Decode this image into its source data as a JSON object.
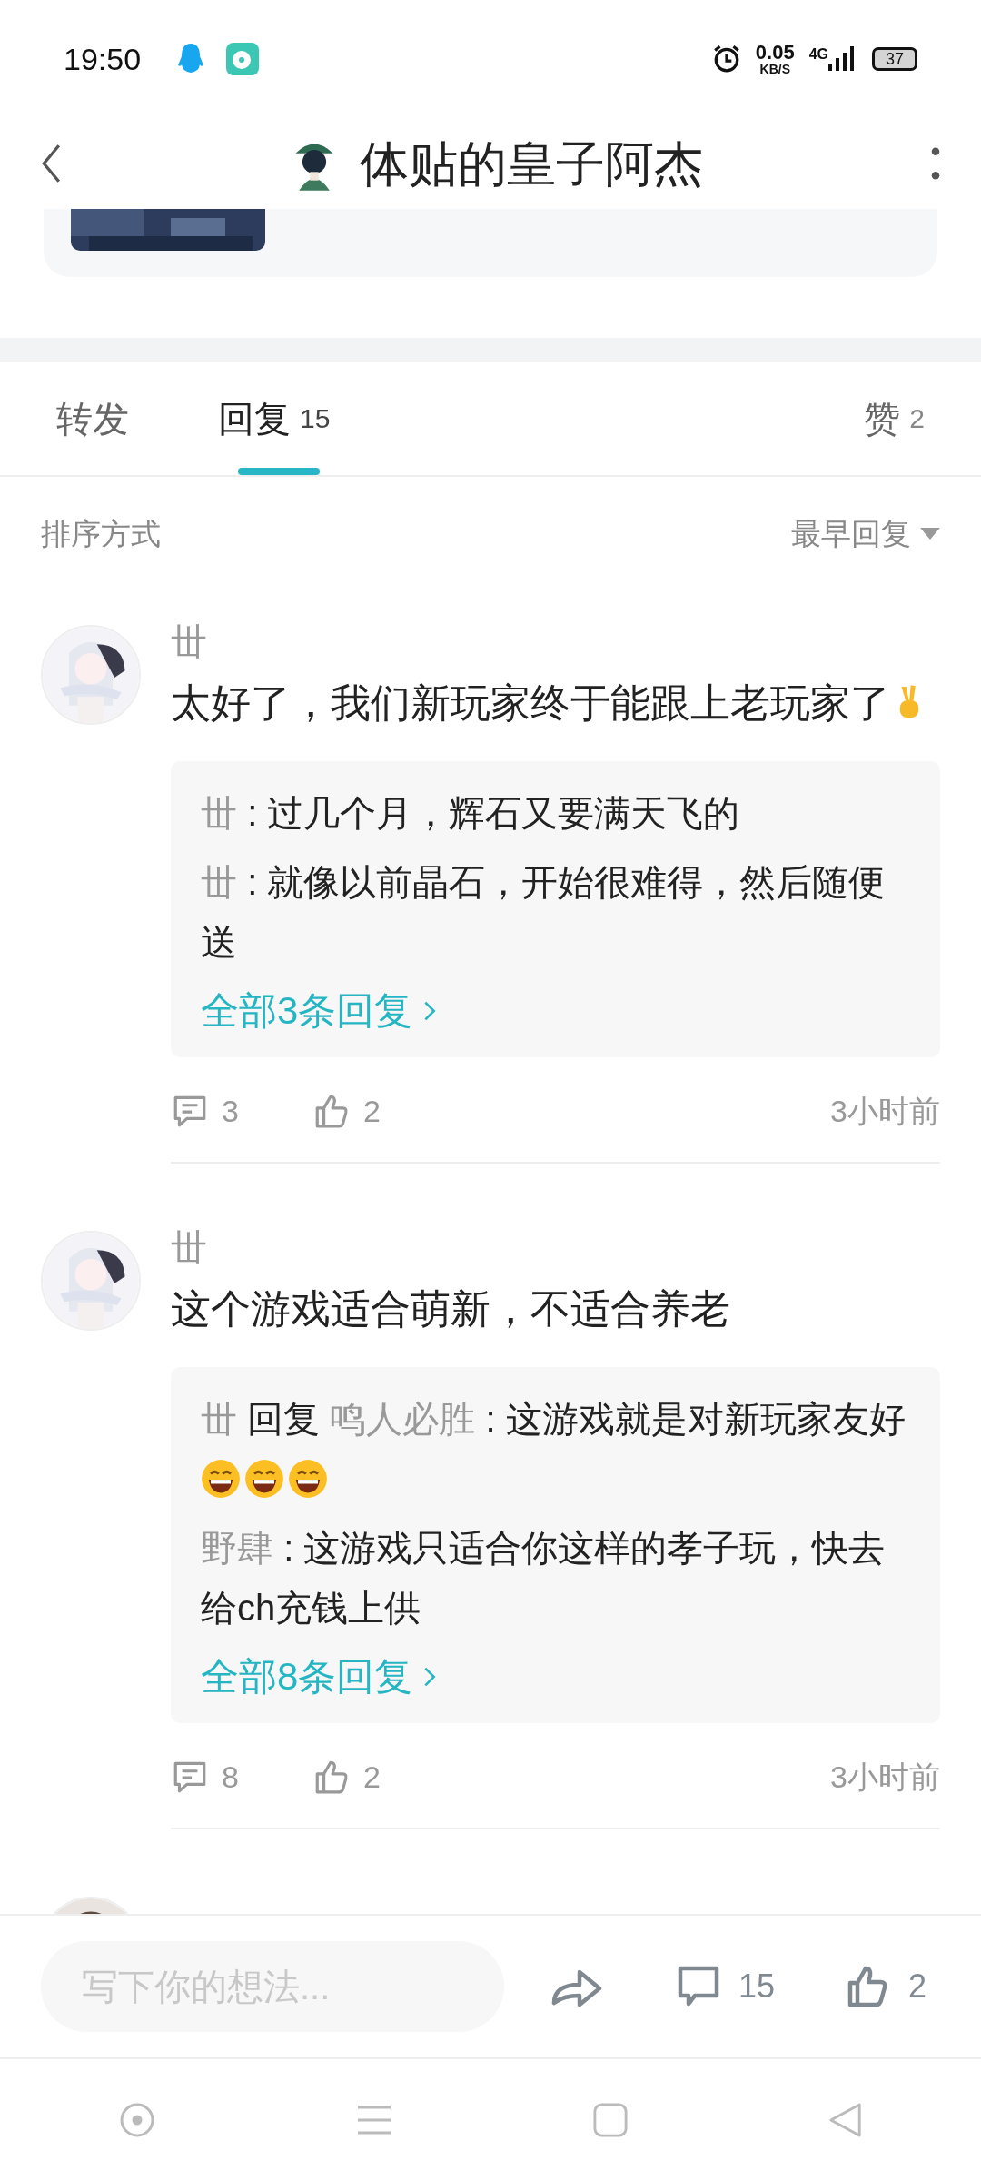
{
  "status_bar": {
    "time": "19:50",
    "net_speed": "0.05",
    "net_unit": "KB/S",
    "network": "4G",
    "battery": "37"
  },
  "header": {
    "title": "体贴的皇子阿杰"
  },
  "tabs": [
    {
      "label": "转发",
      "selected": false
    },
    {
      "label": "回复",
      "count": "15",
      "selected": true
    },
    {
      "label": "赞",
      "count": "2",
      "selected": false
    }
  ],
  "sort": {
    "label": "排序方式",
    "value": "最早回复"
  },
  "comments": [
    {
      "user": "丗",
      "text": "太好了，我们新玩家终于能跟上老玩家了",
      "icons": [
        {
          "kind": "victory"
        }
      ],
      "replies": [
        {
          "user": "丗",
          "sep": ":",
          "text": "过几个月，辉石又要满天飞的"
        },
        {
          "user": "丗",
          "sep": ":",
          "text": "就像以前晶石，开始很难得，然后随便送"
        }
      ],
      "more": "全部3条回复",
      "reply_count": "3",
      "likes": "2",
      "time": "3小时前"
    },
    {
      "user": "丗",
      "text": "这个游戏适合萌新，不适合养老",
      "replies": [
        {
          "user": "丗",
          "reply_word": "回复",
          "reply_to": "鸣人必胜",
          "sep": ":",
          "text": "这游戏就是对新玩家友好",
          "icons": [
            {
              "kind": "grin"
            },
            {
              "kind": "grin"
            },
            {
              "kind": "grin"
            }
          ]
        },
        {
          "user": "野肆",
          "sep": ":",
          "text": "这游戏只适合你这样的孝子玩，快去给ch充钱上供"
        }
      ],
      "more": "全部8条回复",
      "reply_count": "8",
      "likes": "2",
      "time": "3小时前"
    },
    {
      "kind": "partial"
    }
  ],
  "composer": {
    "placeholder": "写下你的想法...",
    "comments": "15",
    "likes": "2"
  }
}
